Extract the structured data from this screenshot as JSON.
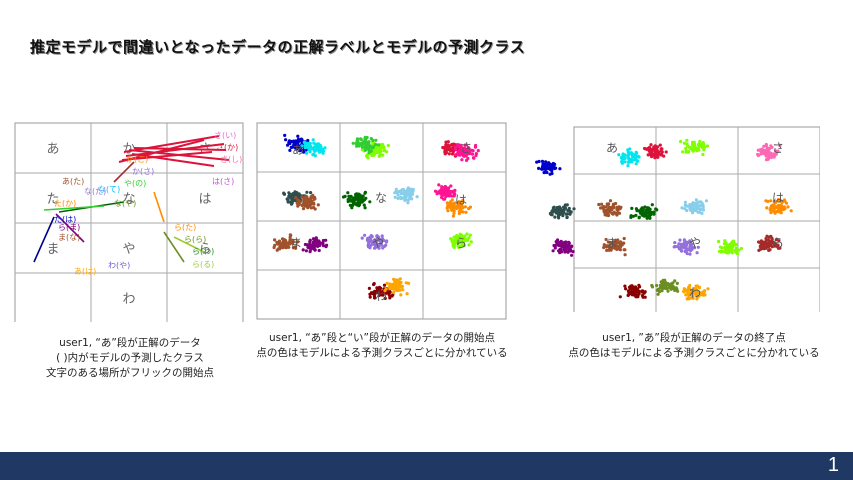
{
  "slide": {
    "title": "推定モデルで間違いとなったデータの正解ラベルとモデルの予測クラス",
    "page_number": "1"
  },
  "grid_kana": [
    "あ",
    "か",
    "さ",
    "た",
    "な",
    "は",
    "ま",
    "や",
    "ら",
    "",
    "わ",
    ""
  ],
  "panel1": {
    "caption": [
      "user1, “あ”段が正解のデータ",
      "( )内がモデルの予測したクラス",
      "文字のある場所がフリックの開始点"
    ],
    "annotations": [
      "さ(い)",
      "さ(か)",
      "さ(し)",
      "か(こ)",
      "か(さ)",
      "あ(た)",
      "な(た)",
      "な(て)",
      "や(の)",
      "な(や)",
      "た(か)",
      "ら(ま)",
      "ま(な)",
      "わ(や)",
      "ら(わ)",
      "ら(る)",
      "あ(は)",
      "は(さ)",
      "ら(ら)",
      "た(は)",
      "ら(た)"
    ]
  },
  "panel2": {
    "caption": [
      "user1, “あ”段と“い”段が正解のデータの開始点",
      "点の色はモデルによる予測クラスごとに分かれている"
    ]
  },
  "panel3": {
    "caption": [
      "user1, ”あ”段が正解のデータの終了点",
      "点の色はモデルによる予測クラスごとに分かれている"
    ]
  },
  "colors": {
    "footer": "#1f3864",
    "clusters": [
      "#0000cd",
      "#00e5ee",
      "#2e8b57",
      "#dc143c",
      "#7fff00",
      "#ff1493",
      "#32cd32",
      "#2f4f4f",
      "#6b8e23",
      "#800080",
      "#a0522d",
      "#00bfff",
      "#ff8c00",
      "#9370db",
      "#8b0000",
      "#ffa500",
      "#da70d6",
      "#87ceeb",
      "#006400",
      "#ff69b4",
      "#a52a2a",
      "#00ced1"
    ]
  }
}
